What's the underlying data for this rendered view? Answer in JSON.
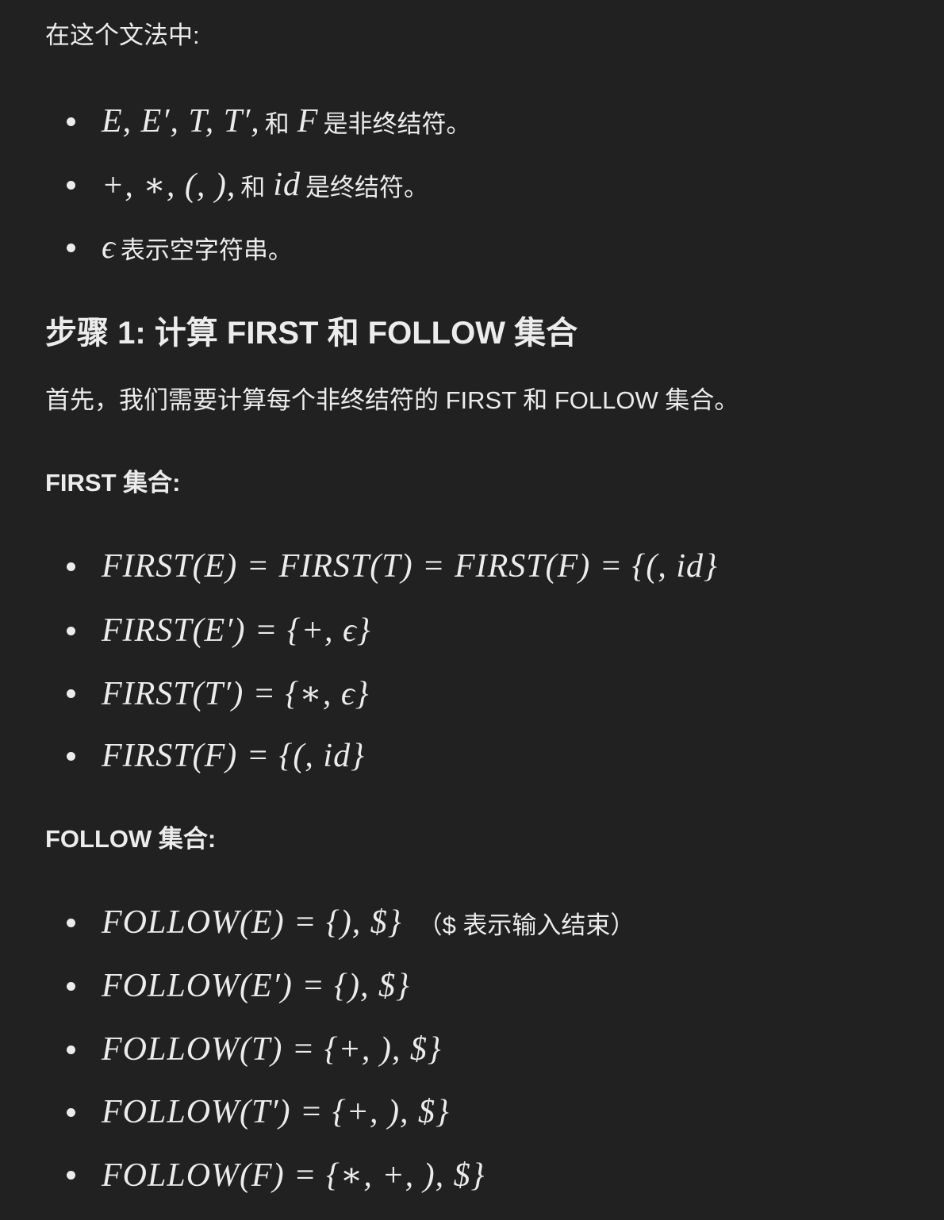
{
  "intro": "在这个文法中:",
  "symbols": [
    {
      "math": "E, E′, T, T′,",
      "text": "和",
      "math2": "F",
      "text2": "是非终结符。"
    },
    {
      "math": "+, ∗, (, ),",
      "text": "和",
      "math2": "id",
      "text2": "是终结符。"
    },
    {
      "math": "ϵ",
      "text": "表示空字符串。",
      "math2": "",
      "text2": ""
    }
  ],
  "step_heading": "步骤 1: 计算 FIRST 和 FOLLOW 集合",
  "step_text": "首先，我们需要计算每个非终结符的 FIRST 和 FOLLOW 集合。",
  "first_heading": "FIRST 集合:",
  "first_items": [
    {
      "math": "FIRST(E) = FIRST(T) = FIRST(F) = {(, id}",
      "note": ""
    },
    {
      "math": "FIRST(E′) = {+, ϵ}",
      "note": ""
    },
    {
      "math": "FIRST(T′) = {∗, ϵ}",
      "note": ""
    },
    {
      "math": "FIRST(F) = {(, id}",
      "note": ""
    }
  ],
  "follow_heading": "FOLLOW 集合:",
  "follow_items": [
    {
      "math": "FOLLOW(E) = {), $}",
      "note": "（$ 表示输入结束）"
    },
    {
      "math": "FOLLOW(E′) = {), $}",
      "note": ""
    },
    {
      "math": "FOLLOW(T) = {+, ), $}",
      "note": ""
    },
    {
      "math": "FOLLOW(T′) = {+, ), $}",
      "note": ""
    },
    {
      "math": "FOLLOW(F) = {∗, +, ), $}",
      "note": ""
    }
  ]
}
